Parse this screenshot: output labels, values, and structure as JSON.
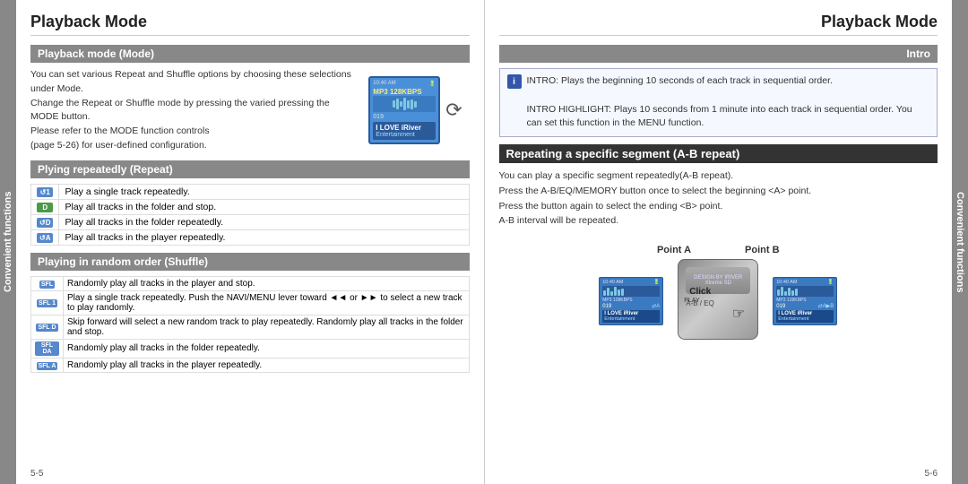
{
  "left_panel": {
    "title": "Playback Mode",
    "section1_header": "Playback mode (Mode)",
    "section1_text": "You can set various Repeat and Shuffle options by choosing these selections under Mode.\nChange the Repeat or Shuffle mode by pressing the varied pressing the MODE button.\nPlease refer to the MODE function controls\n(page 5-26) for user-defined configuration.",
    "section2_header": "Plying repeatedly (Repeat)",
    "repeat_rows": [
      {
        "icon": "↺1",
        "text": "Play a single track repeatedly."
      },
      {
        "icon": "D",
        "text": "Play all tracks in the folder and stop."
      },
      {
        "icon": "↺D",
        "text": "Play all tracks in the folder repeatedly."
      },
      {
        "icon": "↺A",
        "text": "Play all tracks in the player repeatedly."
      }
    ],
    "section3_header": "Playing in random order (Shuffle)",
    "shuffle_rows": [
      {
        "icon": "SFL",
        "text": "Randomly play all tracks in the player and stop."
      },
      {
        "icon": "SFL 1",
        "text": "Play a single track repeatedly. Push the NAVI/MENU lever toward ◄◄ or ►► to select a new track to play randomly."
      },
      {
        "icon": "SFL D",
        "text": "Skip forward will select a new random track to play repeatedly.\nRandomly play all tracks in the folder and stop."
      },
      {
        "icon": "SFL DA",
        "text": "Randomly play all tracks in the folder repeatedly."
      },
      {
        "icon": "SFL A",
        "text": "Randomly play all tracks in the player repeatedly."
      }
    ],
    "page_num": "5-5",
    "device": {
      "time": "10:40 AM",
      "format": "MP3 128KBPS",
      "track_num": "019",
      "love_text": "I LOVE iRiver",
      "entertainment": "Entertainment"
    }
  },
  "right_panel": {
    "title": "Playback Mode",
    "section1_header": "Intro",
    "intro_box": {
      "text1": "INTRO: Plays the beginning 10 seconds of each track in sequential order.",
      "text2": "INTRO HIGHLIGHT: Plays 10 seconds from 1 minute into each track in sequential order. You can set this function in the MENU function."
    },
    "section2_header": "Repeating a specific segment (A-B repeat)",
    "ab_desc1": "You can play a specific segment repeatedly(A-B repeat).",
    "ab_desc2": "Press the A-B/EQ/MEMORY button once to select the beginning <A> point.",
    "ab_desc3": "Press the button again to select the ending <B> point.",
    "ab_desc4": "A-B interval will be repeated.",
    "point_a_label": "Point A",
    "point_b_label": "Point B",
    "click_label": "Click",
    "ab_eq_label": "A-B / EQ",
    "device_left": {
      "time": "10:40 AM",
      "format": "MP3 128KBPS",
      "track_num": "019",
      "love_text": "I LOVE iRiver",
      "entertainment": "Entertainment",
      "indicator": "⇄A"
    },
    "device_right": {
      "time": "10:40 AM",
      "format": "MP3 128KBPS",
      "track_num": "019",
      "love_text": "I LOVE iRiver",
      "entertainment": "Entertainment",
      "indicator": "⇄A▶B"
    },
    "page_num": "5-6"
  },
  "side_label": "Convenient functions"
}
